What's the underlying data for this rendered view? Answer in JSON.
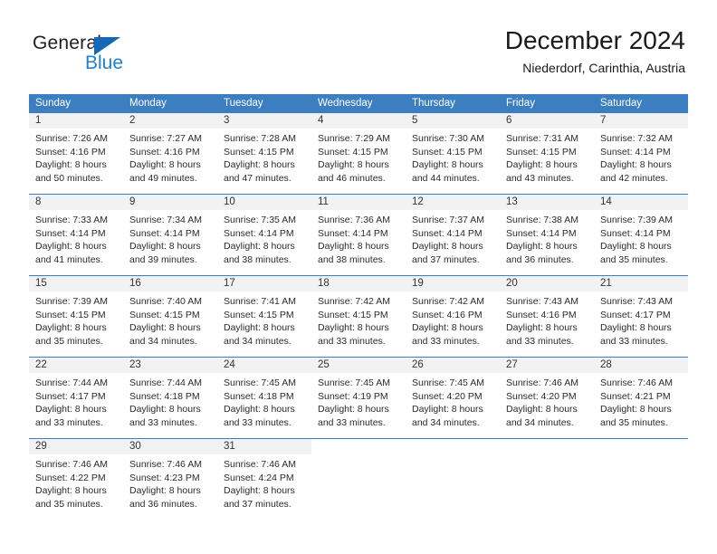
{
  "brand": {
    "name_part1": "General",
    "name_part2": "Blue",
    "triangle_color": "#1567b8",
    "blue_color": "#1f7fd0"
  },
  "header": {
    "title": "December 2024",
    "subtitle": "Niederdorf, Carinthia, Austria"
  },
  "theme": {
    "header_bg": "#3c7fc1",
    "daynum_bg": "#f2f2f2",
    "grid_line": "#3c7fc1"
  },
  "weekday_headers": [
    "Sunday",
    "Monday",
    "Tuesday",
    "Wednesday",
    "Thursday",
    "Friday",
    "Saturday"
  ],
  "weeks": [
    [
      {
        "day": "1",
        "sunrise": "Sunrise: 7:26 AM",
        "sunset": "Sunset: 4:16 PM",
        "daylight1": "Daylight: 8 hours",
        "daylight2": "and 50 minutes."
      },
      {
        "day": "2",
        "sunrise": "Sunrise: 7:27 AM",
        "sunset": "Sunset: 4:16 PM",
        "daylight1": "Daylight: 8 hours",
        "daylight2": "and 49 minutes."
      },
      {
        "day": "3",
        "sunrise": "Sunrise: 7:28 AM",
        "sunset": "Sunset: 4:15 PM",
        "daylight1": "Daylight: 8 hours",
        "daylight2": "and 47 minutes."
      },
      {
        "day": "4",
        "sunrise": "Sunrise: 7:29 AM",
        "sunset": "Sunset: 4:15 PM",
        "daylight1": "Daylight: 8 hours",
        "daylight2": "and 46 minutes."
      },
      {
        "day": "5",
        "sunrise": "Sunrise: 7:30 AM",
        "sunset": "Sunset: 4:15 PM",
        "daylight1": "Daylight: 8 hours",
        "daylight2": "and 44 minutes."
      },
      {
        "day": "6",
        "sunrise": "Sunrise: 7:31 AM",
        "sunset": "Sunset: 4:15 PM",
        "daylight1": "Daylight: 8 hours",
        "daylight2": "and 43 minutes."
      },
      {
        "day": "7",
        "sunrise": "Sunrise: 7:32 AM",
        "sunset": "Sunset: 4:14 PM",
        "daylight1": "Daylight: 8 hours",
        "daylight2": "and 42 minutes."
      }
    ],
    [
      {
        "day": "8",
        "sunrise": "Sunrise: 7:33 AM",
        "sunset": "Sunset: 4:14 PM",
        "daylight1": "Daylight: 8 hours",
        "daylight2": "and 41 minutes."
      },
      {
        "day": "9",
        "sunrise": "Sunrise: 7:34 AM",
        "sunset": "Sunset: 4:14 PM",
        "daylight1": "Daylight: 8 hours",
        "daylight2": "and 39 minutes."
      },
      {
        "day": "10",
        "sunrise": "Sunrise: 7:35 AM",
        "sunset": "Sunset: 4:14 PM",
        "daylight1": "Daylight: 8 hours",
        "daylight2": "and 38 minutes."
      },
      {
        "day": "11",
        "sunrise": "Sunrise: 7:36 AM",
        "sunset": "Sunset: 4:14 PM",
        "daylight1": "Daylight: 8 hours",
        "daylight2": "and 38 minutes."
      },
      {
        "day": "12",
        "sunrise": "Sunrise: 7:37 AM",
        "sunset": "Sunset: 4:14 PM",
        "daylight1": "Daylight: 8 hours",
        "daylight2": "and 37 minutes."
      },
      {
        "day": "13",
        "sunrise": "Sunrise: 7:38 AM",
        "sunset": "Sunset: 4:14 PM",
        "daylight1": "Daylight: 8 hours",
        "daylight2": "and 36 minutes."
      },
      {
        "day": "14",
        "sunrise": "Sunrise: 7:39 AM",
        "sunset": "Sunset: 4:14 PM",
        "daylight1": "Daylight: 8 hours",
        "daylight2": "and 35 minutes."
      }
    ],
    [
      {
        "day": "15",
        "sunrise": "Sunrise: 7:39 AM",
        "sunset": "Sunset: 4:15 PM",
        "daylight1": "Daylight: 8 hours",
        "daylight2": "and 35 minutes."
      },
      {
        "day": "16",
        "sunrise": "Sunrise: 7:40 AM",
        "sunset": "Sunset: 4:15 PM",
        "daylight1": "Daylight: 8 hours",
        "daylight2": "and 34 minutes."
      },
      {
        "day": "17",
        "sunrise": "Sunrise: 7:41 AM",
        "sunset": "Sunset: 4:15 PM",
        "daylight1": "Daylight: 8 hours",
        "daylight2": "and 34 minutes."
      },
      {
        "day": "18",
        "sunrise": "Sunrise: 7:42 AM",
        "sunset": "Sunset: 4:15 PM",
        "daylight1": "Daylight: 8 hours",
        "daylight2": "and 33 minutes."
      },
      {
        "day": "19",
        "sunrise": "Sunrise: 7:42 AM",
        "sunset": "Sunset: 4:16 PM",
        "daylight1": "Daylight: 8 hours",
        "daylight2": "and 33 minutes."
      },
      {
        "day": "20",
        "sunrise": "Sunrise: 7:43 AM",
        "sunset": "Sunset: 4:16 PM",
        "daylight1": "Daylight: 8 hours",
        "daylight2": "and 33 minutes."
      },
      {
        "day": "21",
        "sunrise": "Sunrise: 7:43 AM",
        "sunset": "Sunset: 4:17 PM",
        "daylight1": "Daylight: 8 hours",
        "daylight2": "and 33 minutes."
      }
    ],
    [
      {
        "day": "22",
        "sunrise": "Sunrise: 7:44 AM",
        "sunset": "Sunset: 4:17 PM",
        "daylight1": "Daylight: 8 hours",
        "daylight2": "and 33 minutes."
      },
      {
        "day": "23",
        "sunrise": "Sunrise: 7:44 AM",
        "sunset": "Sunset: 4:18 PM",
        "daylight1": "Daylight: 8 hours",
        "daylight2": "and 33 minutes."
      },
      {
        "day": "24",
        "sunrise": "Sunrise: 7:45 AM",
        "sunset": "Sunset: 4:18 PM",
        "daylight1": "Daylight: 8 hours",
        "daylight2": "and 33 minutes."
      },
      {
        "day": "25",
        "sunrise": "Sunrise: 7:45 AM",
        "sunset": "Sunset: 4:19 PM",
        "daylight1": "Daylight: 8 hours",
        "daylight2": "and 33 minutes."
      },
      {
        "day": "26",
        "sunrise": "Sunrise: 7:45 AM",
        "sunset": "Sunset: 4:20 PM",
        "daylight1": "Daylight: 8 hours",
        "daylight2": "and 34 minutes."
      },
      {
        "day": "27",
        "sunrise": "Sunrise: 7:46 AM",
        "sunset": "Sunset: 4:20 PM",
        "daylight1": "Daylight: 8 hours",
        "daylight2": "and 34 minutes."
      },
      {
        "day": "28",
        "sunrise": "Sunrise: 7:46 AM",
        "sunset": "Sunset: 4:21 PM",
        "daylight1": "Daylight: 8 hours",
        "daylight2": "and 35 minutes."
      }
    ],
    [
      {
        "day": "29",
        "sunrise": "Sunrise: 7:46 AM",
        "sunset": "Sunset: 4:22 PM",
        "daylight1": "Daylight: 8 hours",
        "daylight2": "and 35 minutes."
      },
      {
        "day": "30",
        "sunrise": "Sunrise: 7:46 AM",
        "sunset": "Sunset: 4:23 PM",
        "daylight1": "Daylight: 8 hours",
        "daylight2": "and 36 minutes."
      },
      {
        "day": "31",
        "sunrise": "Sunrise: 7:46 AM",
        "sunset": "Sunset: 4:24 PM",
        "daylight1": "Daylight: 8 hours",
        "daylight2": "and 37 minutes."
      },
      {
        "day": "",
        "sunrise": "",
        "sunset": "",
        "daylight1": "",
        "daylight2": ""
      },
      {
        "day": "",
        "sunrise": "",
        "sunset": "",
        "daylight1": "",
        "daylight2": ""
      },
      {
        "day": "",
        "sunrise": "",
        "sunset": "",
        "daylight1": "",
        "daylight2": ""
      },
      {
        "day": "",
        "sunrise": "",
        "sunset": "",
        "daylight1": "",
        "daylight2": ""
      }
    ]
  ]
}
